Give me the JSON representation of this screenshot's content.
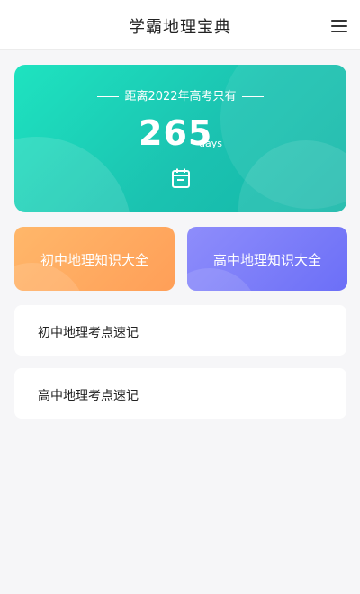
{
  "header": {
    "title": "学霸地理宝典",
    "menu_icon": "hamburger-menu-icon"
  },
  "countdown": {
    "caption": "距离2022年高考只有",
    "days": "265",
    "unit": "days",
    "icon": "calendar-icon"
  },
  "cards": [
    {
      "label": "初中地理知识大全"
    },
    {
      "label": "高中地理知识大全"
    }
  ],
  "list": [
    {
      "label": "初中地理考点速记"
    },
    {
      "label": "高中地理考点速记"
    }
  ],
  "colors": {
    "countdown_gradient": [
      "#1ee3c0",
      "#14b6a8"
    ],
    "card_left": [
      "#ffb76a",
      "#ff9f58"
    ],
    "card_right": [
      "#8e8dfb",
      "#6c6ff7"
    ]
  }
}
